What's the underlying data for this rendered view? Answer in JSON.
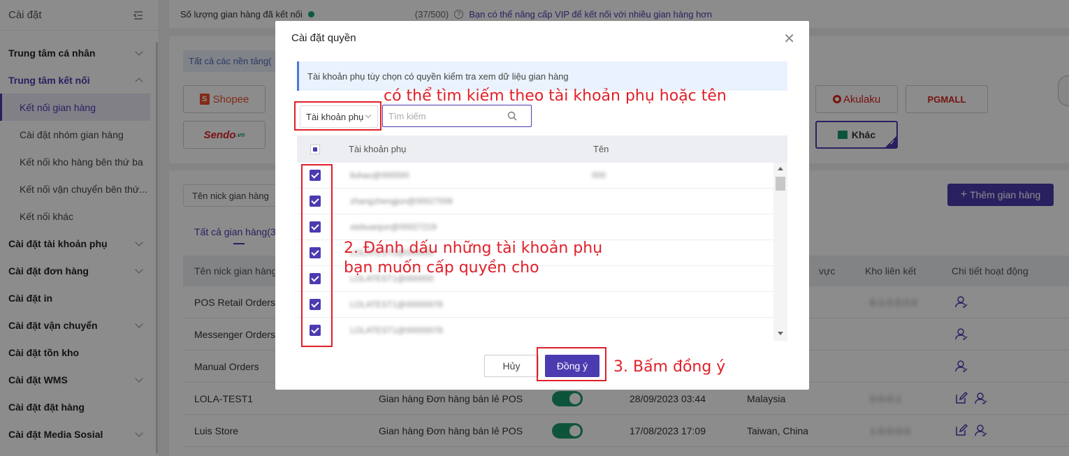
{
  "sidebar": {
    "title": "Cài đặt",
    "items": [
      {
        "label": "Trung tâm cá nhân"
      },
      {
        "label": "Trung tâm kết nối"
      },
      {
        "label": "Kết nối gian hàng"
      },
      {
        "label": "Cài đặt nhóm gian hàng"
      },
      {
        "label": "Kết nối kho hàng bên thứ ba"
      },
      {
        "label": "Kết nối vận chuyển bên thứ..."
      },
      {
        "label": "Kết nối khác"
      },
      {
        "label": "Cài đặt tài khoản phụ"
      },
      {
        "label": "Cài đặt đơn hàng"
      },
      {
        "label": "Cài đặt in"
      },
      {
        "label": "Cài đặt vận chuyển"
      },
      {
        "label": "Cài đặt tồn kho"
      },
      {
        "label": "Cài đặt WMS"
      },
      {
        "label": "Cài đặt đặt hàng"
      },
      {
        "label": "Cài đặt Media Sosial"
      }
    ]
  },
  "topbar": {
    "label": "Số lượng gian hàng đã kết nối",
    "count": "(37/500)",
    "vip": "Bạn có thể nâng cấp VIP để kết nối với nhiều gian hàng hơn"
  },
  "platforms": {
    "tab": "Tất cả các nền tảng(",
    "shopee": "Shopee",
    "sendo": "Sendo",
    "sendo_suffix": ".vn",
    "akulaku": "Akulaku",
    "pgmall": "PGMALL",
    "other": "Khác"
  },
  "shops": {
    "filter": "Tên nick gian hàng",
    "add_button": "Thêm gian hàng",
    "tab_all": "Tất cả gian hàng(30",
    "headers": {
      "name": "Tên nick gian hàng",
      "region": "vực",
      "warehouse": "Kho liên kết",
      "activity": "Chi tiết hoạt động"
    },
    "rows": [
      {
        "name": "POS Retail Orders",
        "type": "",
        "date": "",
        "region": "",
        "warehouse": "6-1-0.0.0.0"
      },
      {
        "name": "Messenger Orders",
        "type": "",
        "date": "",
        "region": "",
        "warehouse": ""
      },
      {
        "name": "Manual Orders",
        "type": "",
        "date": "",
        "region": "",
        "warehouse": ""
      },
      {
        "name": "LOLA-TEST1",
        "type": "Gian hàng Đơn hàng bán lẻ POS",
        "date": "28/09/2023 03:44",
        "region": "Malaysia",
        "warehouse": "0-0-0-1"
      },
      {
        "name": "Luis Store",
        "type": "Gian hàng Đơn hàng bán lẻ POS",
        "date": "17/08/2023 17:09",
        "region": "Taiwan, China",
        "warehouse": "1-0-0-0-0"
      }
    ]
  },
  "modal": {
    "title": "Cài đặt quyền",
    "info": "Tài khoản phụ tùy chọn có quyền kiểm tra xem dữ liệu gian hàng",
    "select_value": "Tài khoản phụ",
    "search_placeholder": "Tìm kiếm",
    "col_account": "Tài khoản phụ",
    "col_name": "Tên",
    "rows": [
      {
        "account": "lluhao@000000",
        "name": "000"
      },
      {
        "account": "zhangzhengjun@00027006",
        "name": ""
      },
      {
        "account": "xiebuanjun@00027219",
        "name": ""
      },
      {
        "account": "LOLATEST2@000000",
        "name": ""
      },
      {
        "account": "LOLATEST1@000000",
        "name": ""
      },
      {
        "account": "LOLATEST1@00000078",
        "name": ""
      },
      {
        "account": "LOLATEST1@00000078",
        "name": ""
      }
    ],
    "cancel": "Hủy",
    "ok": "Đồng ý"
  },
  "annotations": {
    "search_hint": "có thể tìm kiếm theo tài khoản phụ hoặc tên",
    "step2_line1": "2. Đánh dấu những tài khoản phụ",
    "step2_line2": "bạn muốn cấp quyền cho",
    "step3": "3. Bấm đồng ý"
  },
  "colors": {
    "accent": "#4b3bb0",
    "annotation": "#e0202a",
    "toggle": "#1a9a6a"
  }
}
